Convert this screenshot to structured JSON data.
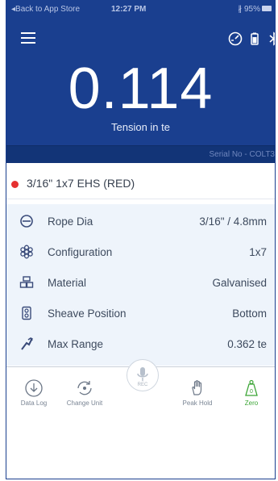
{
  "status_bar": {
    "back_text": "◂Back to App Store",
    "time": "12:27 PM",
    "battery_text": "∦ 95% "
  },
  "header": {
    "reading": "0.114",
    "unit_label": "Tension in te",
    "serial": "Serial No - COLT3"
  },
  "rope": {
    "indicator_color": "#e53030",
    "title": "3/16\" 1x7 EHS (RED)"
  },
  "properties": [
    {
      "icon": "rope-dia-icon",
      "label": "Rope Dia",
      "value": "3/16\" / 4.8mm"
    },
    {
      "icon": "configuration-icon",
      "label": "Configuration",
      "value": "1x7"
    },
    {
      "icon": "material-icon",
      "label": "Material",
      "value": "Galvanised"
    },
    {
      "icon": "sheave-position-icon",
      "label": "Sheave Position",
      "value": "Bottom"
    },
    {
      "icon": "max-range-icon",
      "label": "Max Range",
      "value": "0.362 te"
    }
  ],
  "bottom_bar": {
    "data_log": "Data Log",
    "change_unit": "Change Unit",
    "rec": "REC",
    "peak_hold": "Peak Hold",
    "zero": "Zero"
  },
  "colors": {
    "header_bg": "#1a3f8f",
    "serial_bar_bg": "#123477",
    "panel_bg": "#eef4fb",
    "zero_accent": "#3ba535"
  }
}
